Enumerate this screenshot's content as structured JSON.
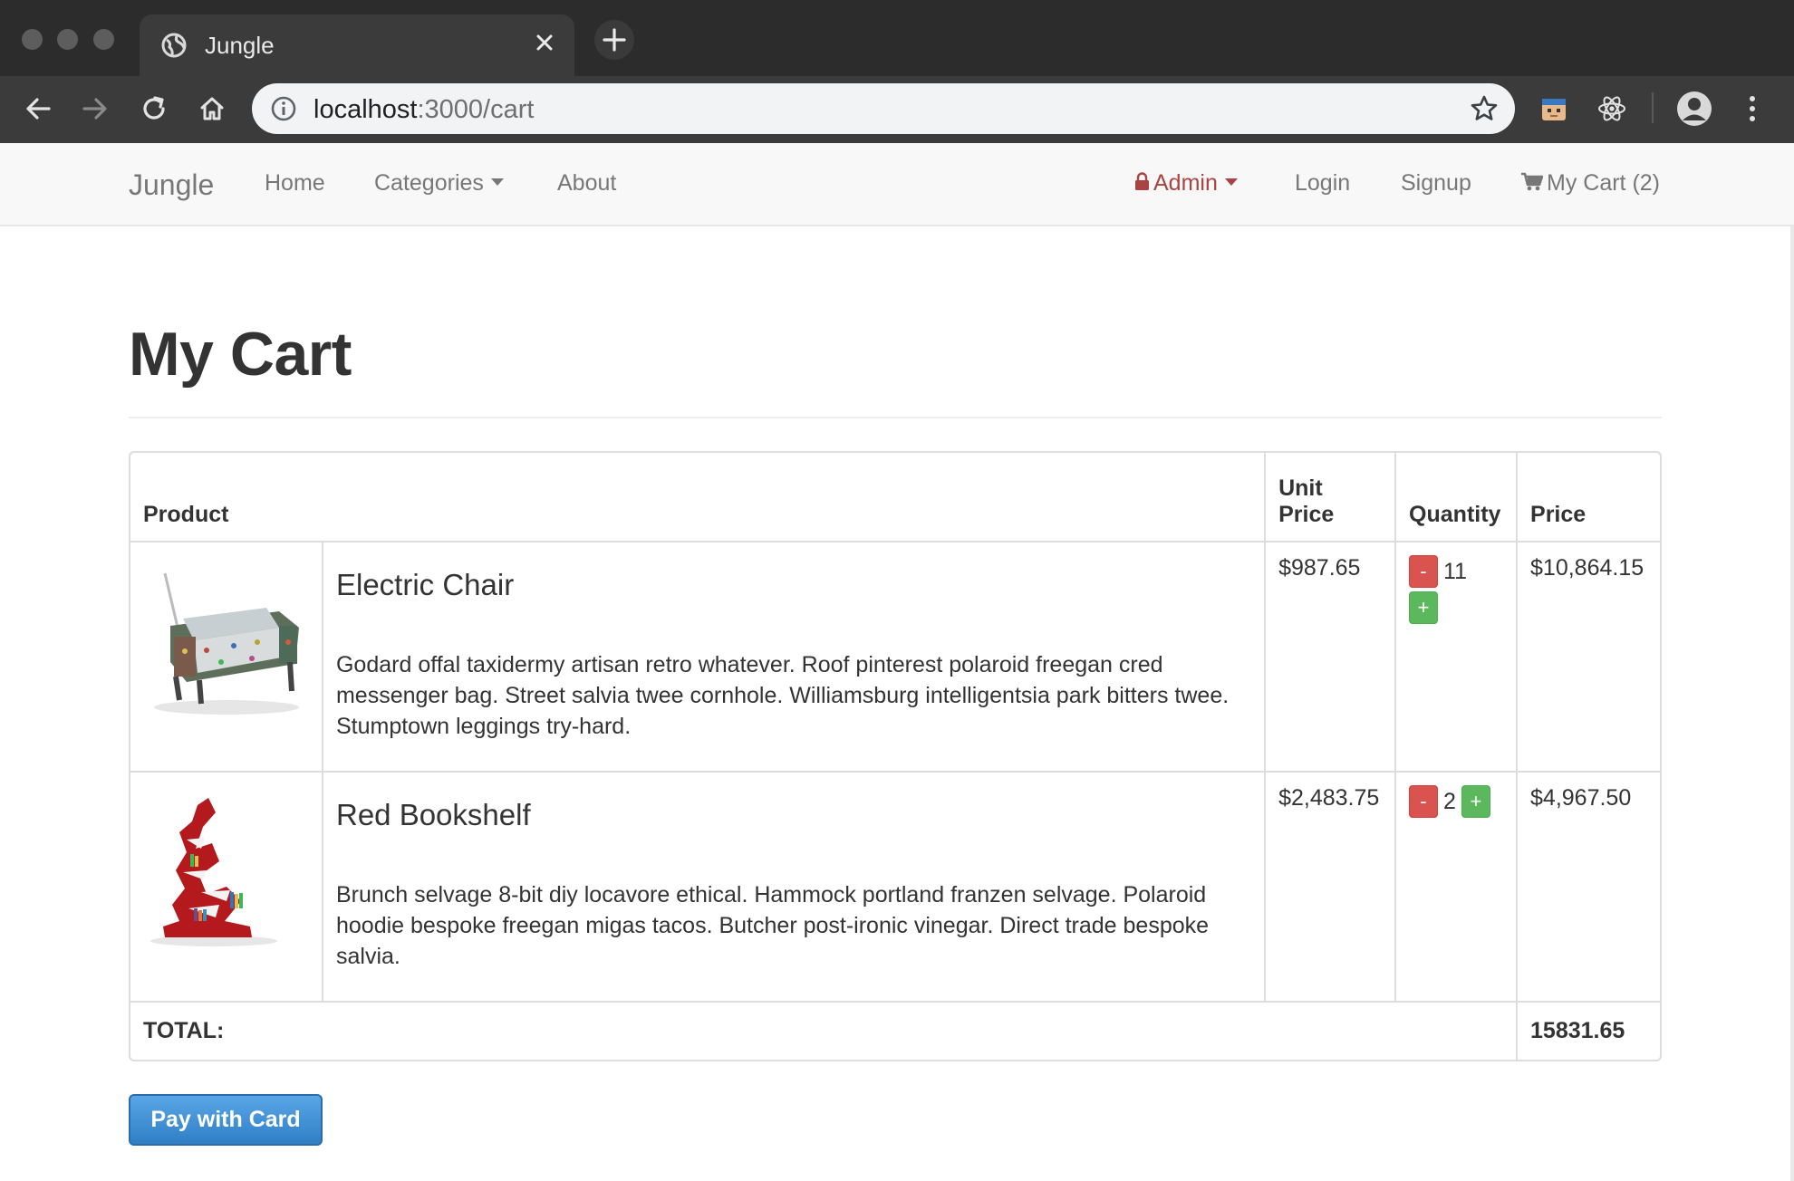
{
  "browser": {
    "tab_title": "Jungle",
    "url_host": "localhost",
    "url_rest": ":3000/cart"
  },
  "navbar": {
    "brand": "Jungle",
    "home": "Home",
    "categories": "Categories",
    "about": "About",
    "admin": "Admin",
    "login": "Login",
    "signup": "Signup",
    "cart": "My Cart (2)",
    "admin_color": "#a94442"
  },
  "page": {
    "title": "My Cart"
  },
  "table": {
    "headers": {
      "product": "Product",
      "unit_price": "Unit Price",
      "quantity": "Quantity",
      "price": "Price"
    },
    "items": [
      {
        "name": "Electric Chair",
        "description": "Godard offal taxidermy artisan retro whatever. Roof pinterest polaroid freegan cred messenger bag. Street salvia twee cornhole. Williamsburg intelligentsia park bitters twee. Stumptown leggings try-hard.",
        "unit_price": "$987.65",
        "quantity": "11",
        "price": "$10,864.15"
      },
      {
        "name": "Red Bookshelf",
        "description": "Brunch selvage 8-bit diy locavore ethical. Hammock portland franzen selvage. Polaroid hoodie bespoke freegan migas tacos. Butcher post-ironic vinegar. Direct trade bespoke salvia.",
        "unit_price": "$2,483.75",
        "quantity": "2",
        "price": "$4,967.50"
      }
    ],
    "total_label": "TOTAL:",
    "total_value": "15831.65",
    "minus": "-",
    "plus": "+"
  },
  "pay_button": "Pay with Card",
  "colors": {
    "minus_btn": "#d9534f",
    "plus_btn": "#5cb85c",
    "pay_btn": "#337ab7"
  }
}
